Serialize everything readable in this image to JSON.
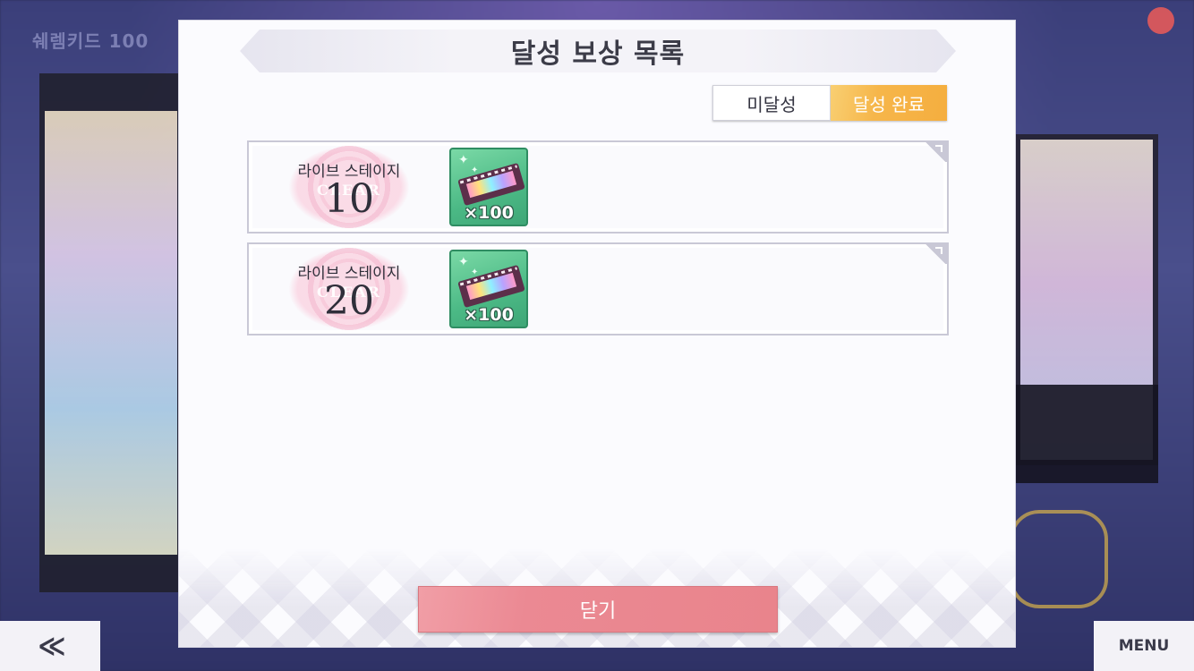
{
  "background": {
    "left_title": "쉐렘키드 100",
    "back_label": "≪",
    "menu_label": "MENU"
  },
  "dialog": {
    "title": "달성 보상 목록",
    "tabs": [
      {
        "label": "미달성",
        "active": false
      },
      {
        "label": "달성 완료",
        "active": true
      }
    ],
    "rewards": [
      {
        "stage_label": "라이브 스테이지",
        "stage_count": "10",
        "stamp_text": "CLEAR",
        "item_icon": "ticket-film-icon",
        "item_qty": "×100"
      },
      {
        "stage_label": "라이브 스테이지",
        "stage_count": "20",
        "stamp_text": "CLEAR",
        "item_icon": "ticket-film-icon",
        "item_qty": "×100"
      }
    ],
    "close_label": "닫기"
  },
  "colors": {
    "active_tab": "#f5ae3f",
    "close_button": "#e9848c",
    "item_tile": "#4bb985"
  }
}
